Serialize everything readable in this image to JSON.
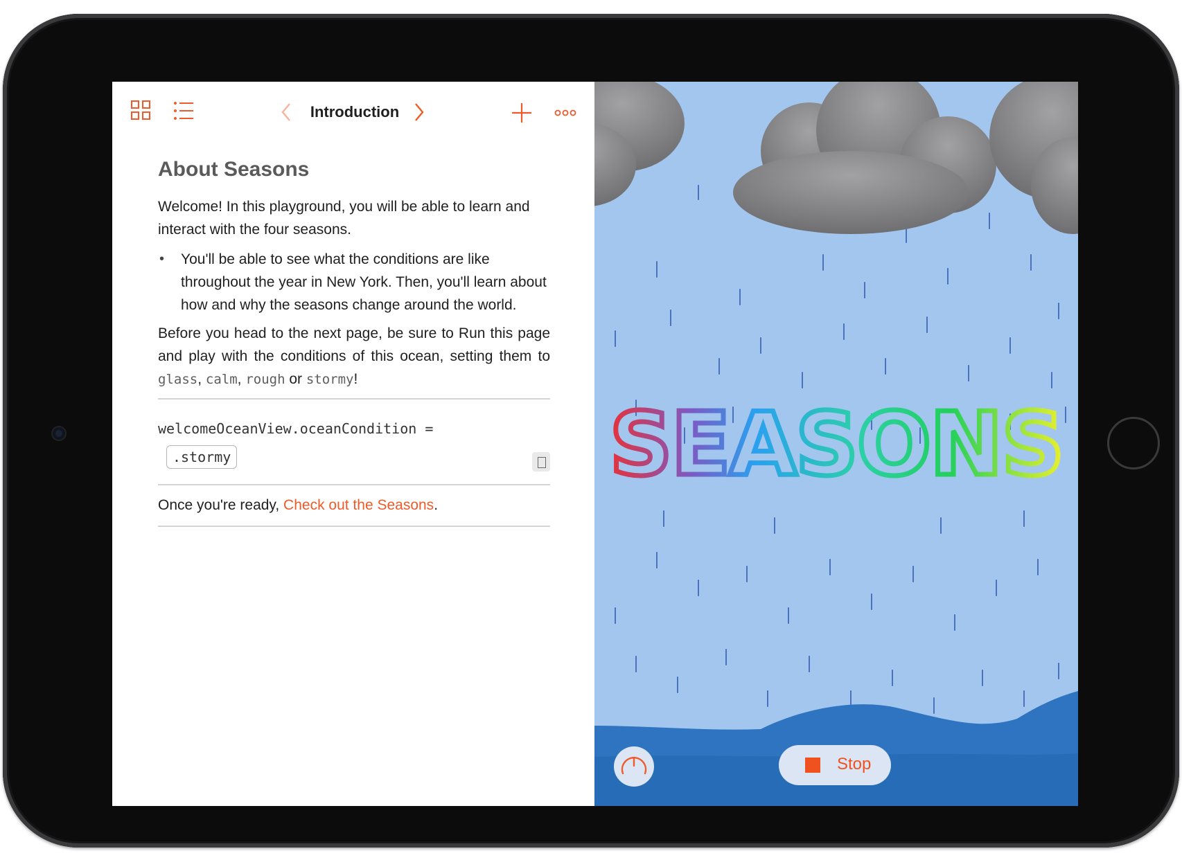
{
  "toolbar": {
    "title": "Introduction",
    "icons": {
      "grid": "grid-icon",
      "list": "list-icon",
      "back": "chevron-left-icon",
      "forward": "chevron-right-icon",
      "add": "plus-icon",
      "more": "more-icon"
    }
  },
  "document": {
    "heading": "About Seasons",
    "intro": "Welcome! In this playground, you will be able to learn and interact with the four seasons.",
    "bullets": [
      "You'll be able to see what the conditions are like throughout the year in New York. Then, you'll learn about how and why the seasons change around the world."
    ],
    "instructions": {
      "text_before": "Before you head to the next page, be sure to Run this page and play with the conditions of this ocean, setting them to ",
      "options": [
        "glass",
        "calm",
        "rough",
        "stormy"
      ],
      "sep1": ", ",
      "sep2": ", ",
      "sep3": " or ",
      "end": "!"
    },
    "code": {
      "line": "welcomeOceanView.oceanCondition =",
      "value": ".stormy"
    },
    "footer": {
      "prefix": "Once you're ready, ",
      "link": "Check out the Seasons",
      "suffix": "."
    }
  },
  "live_view": {
    "title_text": "SEASONS",
    "stop_label": "Stop",
    "accent": "#f0521f",
    "sky_color": "#a3c6ee",
    "sea_color": "#2f74c0"
  },
  "colors": {
    "accent": "#f05a28",
    "bezel": "#0c0c0d"
  }
}
